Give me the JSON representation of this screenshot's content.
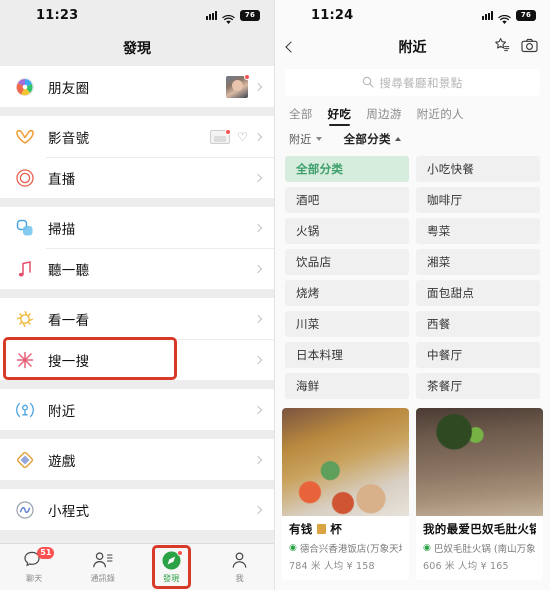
{
  "left": {
    "status": {
      "time": "11:23",
      "battery": "76",
      "signal_icon": "cellular-signal-icon",
      "wifi_icon": "wifi-icon"
    },
    "nav": {
      "title": "發現"
    },
    "groups": [
      {
        "items": [
          {
            "label": "朋友圈",
            "icon": "moments-icon",
            "avatar": true,
            "dot": true
          }
        ]
      },
      {
        "items": [
          {
            "label": "影音號",
            "icon": "channels-icon",
            "thumb": true,
            "heart": "♡",
            "dot": true
          },
          {
            "label": "直播",
            "icon": "live-icon"
          }
        ]
      },
      {
        "items": [
          {
            "label": "掃描",
            "icon": "scan-icon"
          },
          {
            "label": "聽一聽",
            "icon": "listen-icon"
          }
        ]
      },
      {
        "items": [
          {
            "label": "看一看",
            "icon": "top-stories-icon"
          },
          {
            "label": "搜一搜",
            "icon": "search-discover-icon"
          }
        ]
      },
      {
        "items": [
          {
            "label": "附近",
            "icon": "nearby-icon",
            "highlighted": true
          }
        ]
      },
      {
        "items": [
          {
            "label": "遊戲",
            "icon": "games-icon"
          }
        ]
      },
      {
        "items": [
          {
            "label": "小程式",
            "icon": "mini-programs-icon"
          }
        ]
      }
    ],
    "tabbar": [
      {
        "label": "聊天",
        "icon": "chat-icon",
        "badge": "51",
        "active": false
      },
      {
        "label": "通訊錄",
        "icon": "contacts-icon",
        "active": false
      },
      {
        "label": "發現",
        "icon": "discover-compass-icon",
        "active": true,
        "dot": true
      },
      {
        "label": "我",
        "icon": "profile-icon",
        "active": false
      }
    ],
    "highlight_color": "#d83a2a",
    "accent_color": "#2ba245"
  },
  "right": {
    "status": {
      "time": "11:24",
      "battery": "76",
      "signal_icon": "cellular-signal-icon",
      "wifi_icon": "wifi-icon"
    },
    "nav": {
      "title": "附近",
      "back_icon": "back-chevron-icon",
      "star_icon": "star-list-icon",
      "camera_icon": "camera-icon"
    },
    "search": {
      "placeholder": "搜尋餐廳和景點",
      "icon": "search-icon"
    },
    "tabs": [
      {
        "label": "全部",
        "active": false
      },
      {
        "label": "好吃",
        "active": true
      },
      {
        "label": "周边游",
        "active": false
      },
      {
        "label": "附近的人",
        "active": false
      }
    ],
    "filters": [
      {
        "label": "附近",
        "caret": "down",
        "bold": false
      },
      {
        "label": "全部分类",
        "caret": "up",
        "bold": true
      }
    ],
    "categories": [
      {
        "label": "全部分类",
        "selected": true
      },
      {
        "label": "小吃快餐",
        "selected": false
      },
      {
        "label": "酒吧",
        "selected": false
      },
      {
        "label": "咖啡厅",
        "selected": false
      },
      {
        "label": "火锅",
        "selected": false
      },
      {
        "label": "粤菜",
        "selected": false
      },
      {
        "label": "饮品店",
        "selected": false
      },
      {
        "label": "湘菜",
        "selected": false
      },
      {
        "label": "烧烤",
        "selected": false
      },
      {
        "label": "面包甜点",
        "selected": false
      },
      {
        "label": "川菜",
        "selected": false
      },
      {
        "label": "西餐",
        "selected": false
      },
      {
        "label": "日本料理",
        "selected": false
      },
      {
        "label": "中餐厅",
        "selected": false
      },
      {
        "label": "海鲜",
        "selected": false
      },
      {
        "label": "茶餐厅",
        "selected": false
      }
    ],
    "cards": [
      {
        "title_pre": "有钱",
        "title_post": "杯",
        "location": "德合兴香港饭店(万象天地店)",
        "meta": "784 米   人均 ¥ 158",
        "image": "food-photo-dimsum"
      },
      {
        "title_pre": "我的最爱巴奴毛肚火锅",
        "title_post": "",
        "location": "巴奴毛肚火锅 (南山万象天地店)",
        "meta": "606 米   人均 ¥ 165",
        "image": "food-photo-hotpot"
      }
    ],
    "selected_category_bg": "#d6ecdd",
    "selected_category_fg": "#3c9e6a"
  }
}
